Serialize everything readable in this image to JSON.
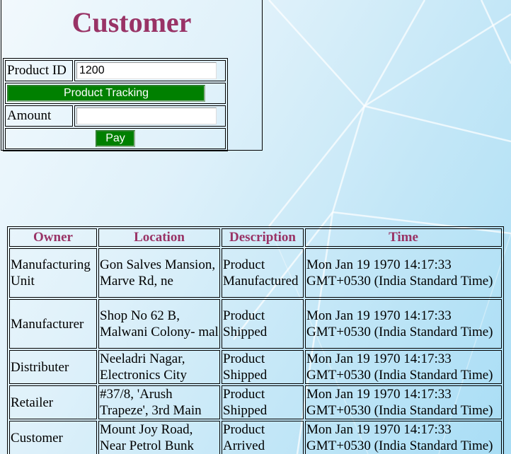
{
  "page": {
    "title": "Customer"
  },
  "form": {
    "product_id_label": "Product ID",
    "product_id_value": "1200",
    "tracking_button": "Product Tracking",
    "amount_label": "Amount",
    "amount_value": "",
    "pay_button": "Pay"
  },
  "history": {
    "headers": [
      "Owner",
      "Location",
      "Description",
      "Time"
    ],
    "rows": [
      {
        "owner": "Manufacturing Unit",
        "location": "Gon Salves Mansion, Marve Rd, ne",
        "description": "Product Manufactured",
        "time": "Mon Jan 19 1970 14:17:33 GMT+0530 (India Standard Time)"
      },
      {
        "owner": "Manufacturer",
        "location": "Shop No 62 B, Malwani Colony- mal",
        "description": "Product Shipped",
        "time": "Mon Jan 19 1970 14:17:33 GMT+0530 (India Standard Time)"
      },
      {
        "owner": "Distributer",
        "location": "Neeladri Nagar, Electronics City",
        "description": "Product Shipped",
        "time": "Mon Jan 19 1970 14:17:33 GMT+0530 (India Standard Time)"
      },
      {
        "owner": "Retailer",
        "location": "#37/8, 'Arush Trapeze', 3rd Main",
        "description": "Product Shipped",
        "time": "Mon Jan 19 1970 14:17:33 GMT+0530 (India Standard Time)"
      },
      {
        "owner": "Customer",
        "location": "Mount Joy Road, Near Petrol Bunk",
        "description": "Product Arrived",
        "time": "Mon Jan 19 1970 14:17:33 GMT+0530 (India Standard Time)"
      }
    ]
  },
  "colors": {
    "title": "#993366",
    "button": "#008000"
  }
}
